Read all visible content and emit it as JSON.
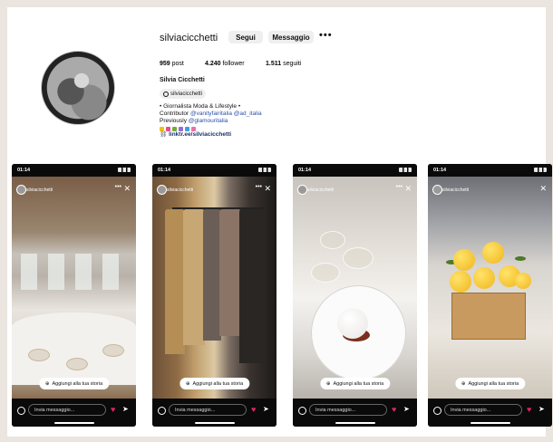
{
  "profile": {
    "username": "silviacicchetti",
    "follow_label": "Segui",
    "message_label": "Messaggio",
    "more_label": "•••",
    "stats": {
      "posts_num": "959",
      "posts_label": "post",
      "followers_num": "4.240",
      "followers_label": "follower",
      "following_num": "1.511",
      "following_label": "seguiti"
    },
    "full_name": "Silvia Cicchetti",
    "threads_handle": "silviacicchetti",
    "bio_line1": "• Giornalista Moda & Lifestyle •",
    "bio_line2_prefix": "Contributor ",
    "bio_tag1": "@vanityfairitalia",
    "bio_tag2": "@ad_italia",
    "bio_line3_prefix": "Previously ",
    "bio_tag3": "@glamouritalia",
    "link": "linktr.ee/silviacicchetti"
  },
  "stories": [
    {
      "time": "01:14",
      "user": "silviacicchetti",
      "add_label": "Aggiungi alla tua storia",
      "input_placeholder": "Invia messaggio..."
    },
    {
      "time": "01:14",
      "user": "silviacicchetti",
      "add_label": "Aggiungi alla tua storia",
      "input_placeholder": "Invia messaggio..."
    },
    {
      "time": "01:14",
      "user": "silviacicchetti",
      "add_label": "Aggiungi alla tua storia",
      "input_placeholder": "Invia messaggio..."
    },
    {
      "time": "01:14",
      "user": "silviacicchetti",
      "add_label": "Aggiungi alla tua storia",
      "input_placeholder": "Invia messaggio..."
    }
  ],
  "colors": {
    "link": "#2b4fa8",
    "heart": "#e0245e"
  }
}
